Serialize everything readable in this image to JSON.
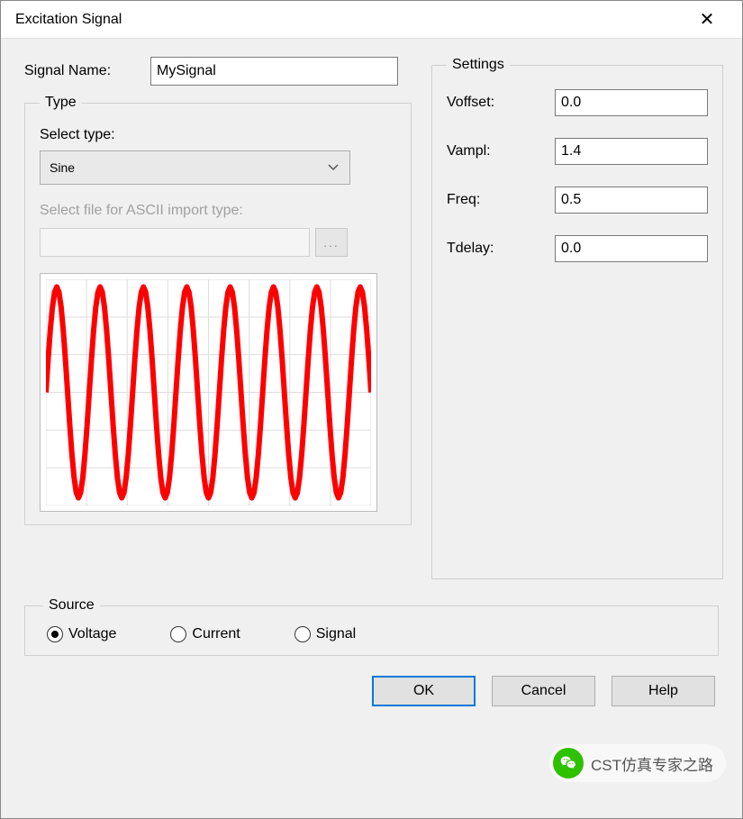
{
  "window": {
    "title": "Excitation Signal"
  },
  "form": {
    "signal_name_label": "Signal Name:",
    "signal_name_value": "MySignal"
  },
  "type_group": {
    "legend": "Type",
    "select_label": "Select type:",
    "select_value": "Sine",
    "file_label": "Select file for ASCII import type:",
    "file_value": "",
    "browse_label": "..."
  },
  "chart_data": {
    "type": "line",
    "title": "",
    "xlabel": "",
    "ylabel": "",
    "x": [
      0,
      0.05,
      0.1,
      0.15,
      0.2,
      0.25,
      0.3,
      0.35,
      0.4,
      0.45,
      0.5,
      0.55,
      0.6,
      0.65,
      0.7,
      0.75,
      0.8,
      0.85,
      0.9,
      0.95,
      1,
      1.05,
      1.1,
      1.15,
      1.2,
      1.25,
      1.3,
      1.35,
      1.4,
      1.45,
      1.5,
      1.55,
      1.6,
      1.65,
      1.7,
      1.75,
      1.8,
      1.85,
      1.9,
      1.95,
      2,
      2.05,
      2.1,
      2.15,
      2.2,
      2.25,
      2.3,
      2.35,
      2.4,
      2.45,
      2.5,
      2.55,
      2.6,
      2.65,
      2.7,
      2.75,
      2.8,
      2.85,
      2.9,
      2.95,
      3,
      3.05,
      3.1,
      3.15,
      3.2,
      3.25,
      3.3,
      3.35,
      3.4,
      3.45,
      3.5,
      3.55,
      3.6,
      3.65,
      3.7,
      3.75,
      3.8,
      3.85,
      3.9,
      3.95,
      4,
      4.05,
      4.1,
      4.15,
      4.2,
      4.25,
      4.3,
      4.35,
      4.4,
      4.45,
      4.5,
      4.55,
      4.6,
      4.65,
      4.7,
      4.75,
      4.8,
      4.85,
      4.9,
      4.95,
      5,
      5.05,
      5.1,
      5.15,
      5.2,
      5.25,
      5.3,
      5.35,
      5.4,
      5.45,
      5.5,
      5.55,
      5.6,
      5.65,
      5.7,
      5.75,
      5.8,
      5.85,
      5.9,
      5.95,
      6,
      6.05,
      6.1,
      6.15,
      6.2,
      6.25,
      6.3,
      6.35,
      6.4,
      6.45,
      6.5,
      6.55,
      6.6,
      6.65,
      6.7,
      6.75,
      6.8,
      6.85,
      6.9,
      6.95,
      7,
      7.05,
      7.1,
      7.15,
      7.2,
      7.25,
      7.3,
      7.35,
      7.4,
      7.45,
      7.5
    ],
    "y": [
      0,
      0.433,
      0.823,
      1.133,
      1.331,
      1.4,
      1.331,
      1.133,
      0.823,
      0.433,
      0,
      -0.433,
      -0.823,
      -1.133,
      -1.331,
      -1.4,
      -1.331,
      -1.133,
      -0.823,
      -0.433,
      0,
      0.433,
      0.823,
      1.133,
      1.331,
      1.4,
      1.331,
      1.133,
      0.823,
      0.433,
      0,
      -0.433,
      -0.823,
      -1.133,
      -1.331,
      -1.4,
      -1.331,
      -1.133,
      -0.823,
      -0.433,
      0,
      0.433,
      0.823,
      1.133,
      1.331,
      1.4,
      1.331,
      1.133,
      0.823,
      0.433,
      0,
      -0.433,
      -0.823,
      -1.133,
      -1.331,
      -1.4,
      -1.331,
      -1.133,
      -0.823,
      -0.433,
      0,
      0.433,
      0.823,
      1.133,
      1.331,
      1.4,
      1.331,
      1.133,
      0.823,
      0.433,
      0,
      -0.433,
      -0.823,
      -1.133,
      -1.331,
      -1.4,
      -1.331,
      -1.133,
      -0.823,
      -0.433,
      0,
      0.433,
      0.823,
      1.133,
      1.331,
      1.4,
      1.331,
      1.133,
      0.823,
      0.433,
      0,
      -0.433,
      -0.823,
      -1.133,
      -1.331,
      -1.4,
      -1.331,
      -1.133,
      -0.823,
      -0.433,
      0,
      0.433,
      0.823,
      1.133,
      1.331,
      1.4,
      1.331,
      1.133,
      0.823,
      0.433,
      0,
      -0.433,
      -0.823,
      -1.133,
      -1.331,
      -1.4,
      -1.331,
      -1.133,
      -0.823,
      -0.433,
      0,
      0.433,
      0.823,
      1.133,
      1.331,
      1.4,
      1.331,
      1.133,
      0.823,
      0.433,
      0,
      -0.433,
      -0.823,
      -1.133,
      -1.331,
      -1.4,
      -1.331,
      -1.133,
      -0.823,
      -0.433,
      0,
      0.433,
      0.823,
      1.133,
      1.331,
      1.4,
      1.331,
      1.133,
      0.823,
      0.433,
      0
    ],
    "xlim": [
      0,
      7.5
    ],
    "ylim": [
      -1.5,
      1.5
    ],
    "grid": true,
    "color": "#ff0000"
  },
  "settings": {
    "legend": "Settings",
    "fields": [
      {
        "label": "Voffset:",
        "value": "0.0"
      },
      {
        "label": "Vampl:",
        "value": "1.4"
      },
      {
        "label": "Freq:",
        "value": "0.5"
      },
      {
        "label": "Tdelay:",
        "value": "0.0"
      }
    ]
  },
  "source": {
    "legend": "Source",
    "options": [
      {
        "label": "Voltage",
        "checked": true
      },
      {
        "label": "Current",
        "checked": false
      },
      {
        "label": "Signal",
        "checked": false
      }
    ]
  },
  "buttons": {
    "ok": "OK",
    "cancel": "Cancel",
    "help": "Help"
  },
  "watermark": {
    "text": "CST仿真专家之路"
  }
}
